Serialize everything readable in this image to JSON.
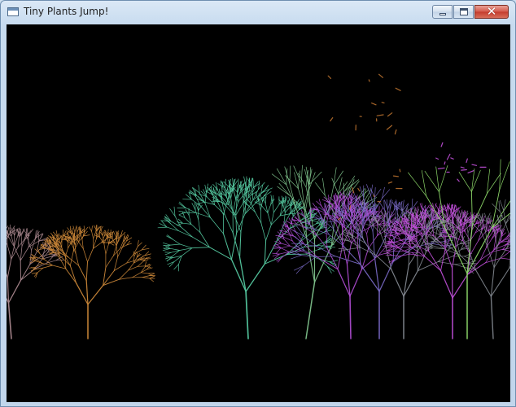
{
  "window": {
    "title": "Tiny Plants Jump!",
    "controls": [
      "minimize",
      "maximize",
      "close"
    ]
  },
  "scene": {
    "background": "#000000",
    "plant_colors": [
      "#a8868c",
      "#c98638",
      "#54c79f",
      "#7dc08a",
      "#b24ed6",
      "#7a6ac8",
      "#8a8f98",
      "#c04fd8",
      "#8fdb6a"
    ],
    "particle_colors": [
      "#c04fd8",
      "#b8702e",
      "#55b58a"
    ]
  }
}
